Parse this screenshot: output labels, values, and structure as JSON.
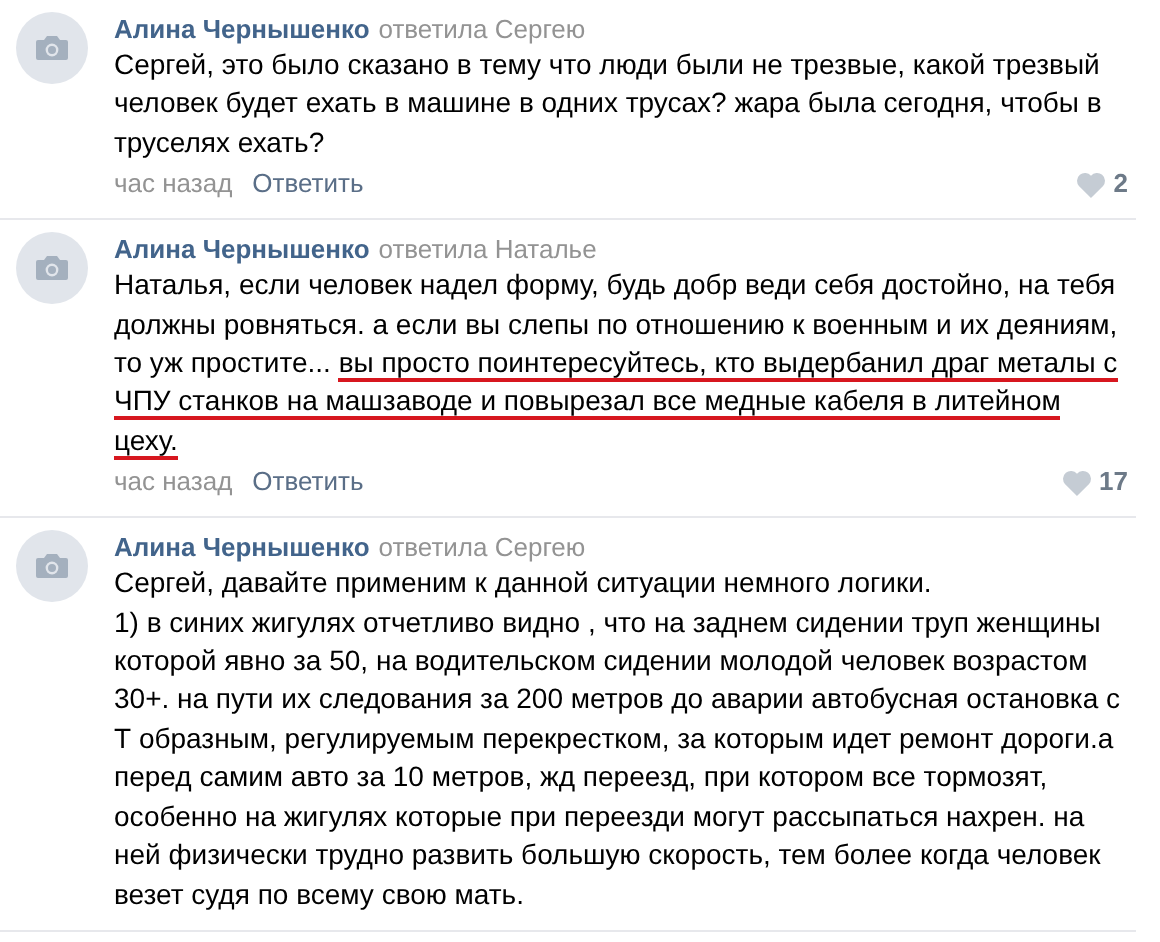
{
  "comments": [
    {
      "author": "Алина Чернышенко",
      "reply_to": "ответила Сергею",
      "segments": [
        {
          "text": "Сергей, это было сказано в тему что люди были не трезвые, какой трезвый человек будет ехать в машине в одних трусах? жара была сегодня, чтобы в труселях ехать?",
          "underlined": false
        }
      ],
      "time": "час назад",
      "reply": "Ответить",
      "likes": "2"
    },
    {
      "author": "Алина Чернышенко",
      "reply_to": "ответила Наталье",
      "segments": [
        {
          "text": "Наталья, если человек надел форму, будь добр веди себя достойно, на тебя должны ровняться. а если вы слепы по отношению к военным и их деяниям, то уж простите... ",
          "underlined": false
        },
        {
          "text": "вы просто поинтересуйтесь, кто выдербанил драг металы с ЧПУ станков на машзаводе и повырезал все медные кабеля в литейном цеху.",
          "underlined": true
        }
      ],
      "time": "час назад",
      "reply": "Ответить",
      "likes": "17"
    },
    {
      "author": "Алина Чернышенко",
      "reply_to": "ответила Сергею",
      "segments": [
        {
          "text": "Сергей, давайте применим к данной ситуации немного логики.\n1) в синих жигулях отчетливо видно , что на заднем сидении труп женщины которой явно за 50, на водительском сидении молодой человек возрастом 30+. на пути их следования за 200 метров до аварии автобусная остановка с Т образным, регулируемым перекрестком, за которым идет ремонт дороги.а перед самим авто за 10 метров, жд переезд, при котором все тормозят, особенно на жигулях которые при переезди могут рассыпаться нахрен. на ней физически трудно развить большую скорость, тем более когда человек везет судя по всему свою мать.",
          "underlined": false
        }
      ]
    }
  ]
}
